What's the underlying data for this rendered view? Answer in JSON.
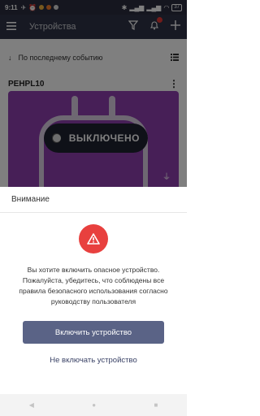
{
  "status_bar": {
    "time": "9:11",
    "battery": "37",
    "notification_dot_colors": [
      "#f0b23c",
      "#f07a2c",
      "#d9d9d9"
    ]
  },
  "app_bar": {
    "title": "Устройства",
    "icons": [
      "menu-icon",
      "filter-icon",
      "bell-icon",
      "add-icon"
    ],
    "badge_color": "#e53935"
  },
  "list": {
    "sort_label": "По последнему событию",
    "device_name": "PEHPL10",
    "device_state": "ВЫКЛЮЧЕНО",
    "card_color": "#8e3fae"
  },
  "dialog": {
    "title": "Внимание",
    "warning_color": "#e8403e",
    "message": "Вы хотите включить опасное устройство. Пожалуйста, убедитесь, что соблюдены все правила безопасного использования согласно руководству пользователя",
    "confirm_label": "Включить устройство",
    "cancel_label": "Не включать устройство",
    "confirm_color": "#5a6386"
  }
}
